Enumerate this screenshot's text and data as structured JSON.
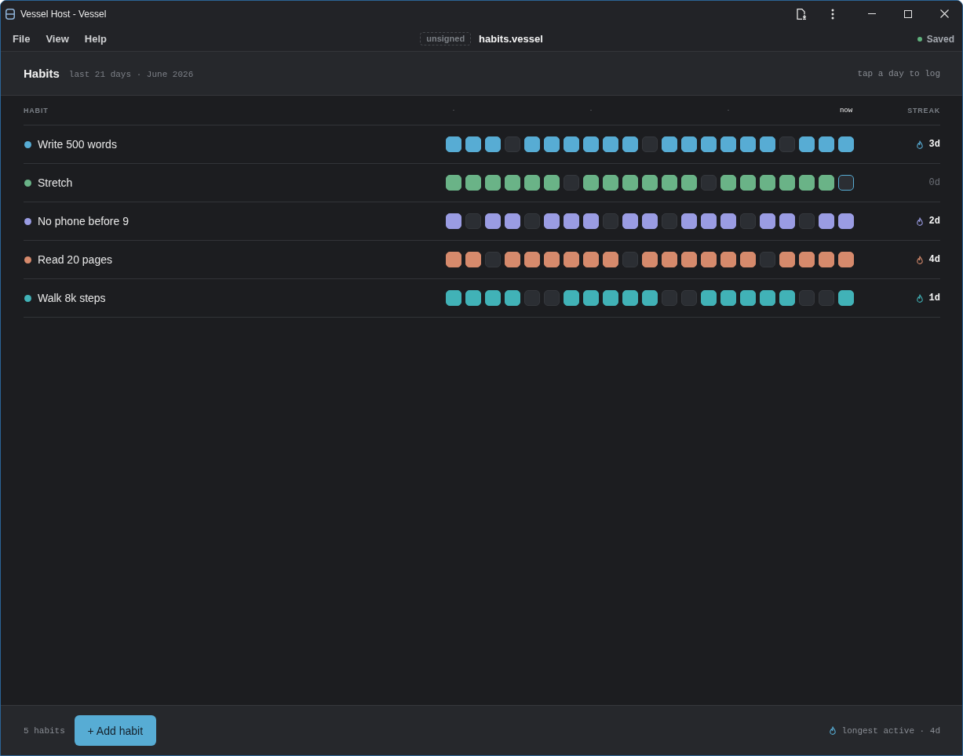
{
  "window": {
    "title": "Vessel Host - Vessel"
  },
  "menu": [
    "File",
    "View",
    "Help"
  ],
  "document": {
    "badge": "unsigned",
    "name": "habits.vessel",
    "status": "Saved"
  },
  "header": {
    "title": "Habits",
    "subtitle": "last 21 days · June 2026",
    "hint": "tap a day to log"
  },
  "table": {
    "columns": [
      "HABIT",
      "STREAK"
    ],
    "week_marks": [
      "·",
      "·",
      "·"
    ],
    "today_label": "now"
  },
  "habits": [
    {
      "name": "Write 500 words",
      "color": "#57acd4",
      "days": [
        true,
        true,
        true,
        false,
        true,
        true,
        true,
        true,
        true,
        true,
        false,
        true,
        true,
        true,
        true,
        true,
        true,
        false,
        true,
        true,
        true
      ],
      "streak": "3d",
      "streak_active": true
    },
    {
      "name": "Stretch",
      "color": "#6ab387",
      "days": [
        true,
        true,
        true,
        true,
        true,
        true,
        false,
        true,
        true,
        true,
        true,
        true,
        true,
        false,
        true,
        true,
        true,
        true,
        true,
        true,
        false
      ],
      "streak": "0d",
      "streak_active": false
    },
    {
      "name": "No phone before 9",
      "color": "#9a9ce3",
      "days": [
        true,
        false,
        true,
        true,
        false,
        true,
        true,
        true,
        false,
        true,
        true,
        false,
        true,
        true,
        true,
        false,
        true,
        true,
        false,
        true,
        true
      ],
      "streak": "2d",
      "streak_active": true
    },
    {
      "name": "Read 20 pages",
      "color": "#d68a6c",
      "days": [
        true,
        true,
        false,
        true,
        true,
        true,
        true,
        true,
        true,
        false,
        true,
        true,
        true,
        true,
        true,
        true,
        false,
        true,
        true,
        true,
        true
      ],
      "streak": "4d",
      "streak_active": true
    },
    {
      "name": "Walk 8k steps",
      "color": "#41b2b7",
      "days": [
        true,
        true,
        true,
        true,
        false,
        false,
        true,
        true,
        true,
        true,
        true,
        false,
        false,
        true,
        true,
        true,
        true,
        true,
        false,
        false,
        true
      ],
      "streak": "1d",
      "streak_active": true
    }
  ],
  "footer": {
    "count": "5 habits",
    "add_button": "+ Add habit",
    "summary": "longest active · 4d"
  }
}
